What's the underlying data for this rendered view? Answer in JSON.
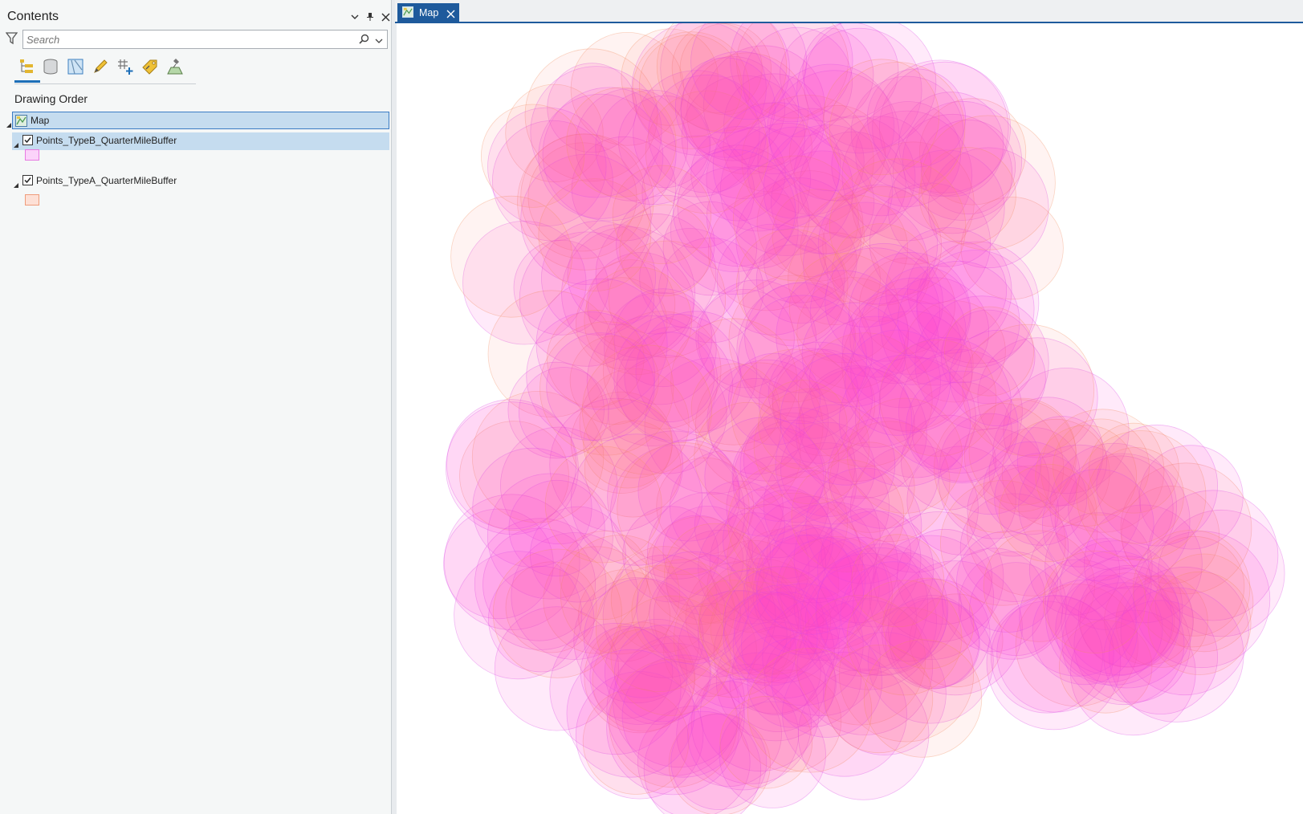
{
  "contents": {
    "title": "Contents",
    "search": {
      "placeholder": "Search",
      "value": ""
    },
    "toolbar": {
      "buttons": [
        "list-by-drawing-order-icon",
        "list-by-source-icon",
        "list-by-selection-icon",
        "list-by-editing-icon",
        "list-by-snapping-icon",
        "list-by-labeling-icon",
        "list-by-perspective-imagery-icon"
      ]
    },
    "section_label": "Drawing Order",
    "map_item": {
      "label": "Map"
    },
    "layers": [
      {
        "label": "Points_TypeB_QuarterMileBuffer",
        "checked": true,
        "swatch_fill": "#fbd3fa",
        "swatch_stroke": "#e77be2"
      },
      {
        "label": "Points_TypeA_QuarterMileBuffer",
        "checked": true,
        "swatch_fill": "#fde0d6",
        "swatch_stroke": "#ef9c7b"
      }
    ]
  },
  "map_view": {
    "tab_label": "Map",
    "colors": {
      "type_b_fill": "#ff3fd0",
      "type_b_stroke": "#d94ee6",
      "type_a_fill": "#ff7a6a",
      "type_a_stroke": "#f09060",
      "selection_accent": "#1e5a9c"
    }
  }
}
